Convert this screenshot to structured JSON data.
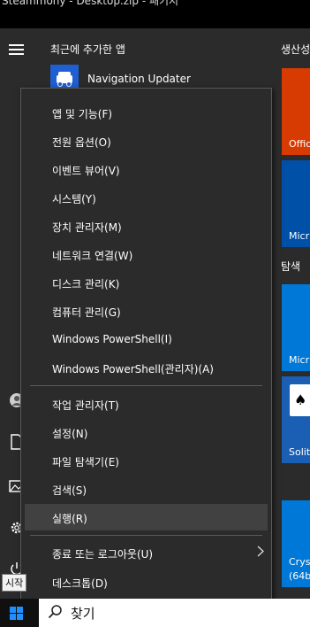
{
  "window_title_fragment": "Steammony - Desktop.zip - 패키지",
  "start_menu": {
    "recent_label": "최근에 추가한 앱",
    "recent_app": "Navigation Updater",
    "group_productivity": "생산성",
    "group_explore": "탐색",
    "tiles": [
      {
        "label": "Offic",
        "color": "#d83b01"
      },
      {
        "label": "Micr",
        "color": "#0050a8"
      },
      {
        "label": "Micr",
        "color": "#0078d7"
      },
      {
        "label": "Solita",
        "color": "#1a5fb4"
      },
      {
        "label": "Cryst\n(64b",
        "color": "#0078d7"
      }
    ]
  },
  "context_menu": {
    "items": [
      "앱 및 기능(F)",
      "전원 옵션(O)",
      "이벤트 뷰어(V)",
      "시스템(Y)",
      "장치 관리자(M)",
      "네트워크 연결(W)",
      "디스크 관리(K)",
      "컴퓨터 관리(G)",
      "Windows PowerShell(I)",
      "Windows PowerShell(관리자)(A)",
      "작업 관리자(T)",
      "설정(N)",
      "파일 탐색기(E)",
      "검색(S)",
      "실행(R)",
      "종료 또는 로그아웃(U)",
      "데스크톱(D)"
    ]
  },
  "tooltip": "시작",
  "taskbar": {
    "search_text": "찾기"
  }
}
